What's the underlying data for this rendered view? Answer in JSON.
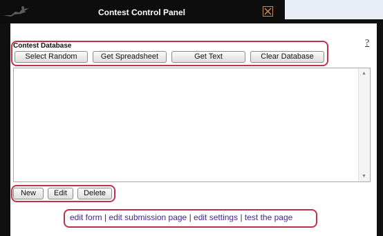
{
  "window": {
    "title": "Contest Control Panel",
    "close_icon": "close-icon"
  },
  "help": {
    "label": "?"
  },
  "database_group": {
    "label": "Contest Database",
    "buttons": [
      {
        "label": "Select Random"
      },
      {
        "label": "Get Spreadsheet"
      },
      {
        "label": "Get Text"
      },
      {
        "label": "Clear Database"
      }
    ]
  },
  "entries_textarea": {
    "value": ""
  },
  "entry_actions": [
    {
      "label": "New"
    },
    {
      "label": "Edit"
    },
    {
      "label": "Delete"
    }
  ],
  "footer_links": {
    "edit_form": "edit form",
    "edit_submission_page": "edit submission page",
    "edit_settings": "edit settings",
    "test_the_page": "test the page",
    "separator": "|"
  },
  "colors": {
    "frame": "#101010",
    "highlight": "#c0304a",
    "link": "#4a1e8f",
    "close_border": "#c88b5b"
  }
}
